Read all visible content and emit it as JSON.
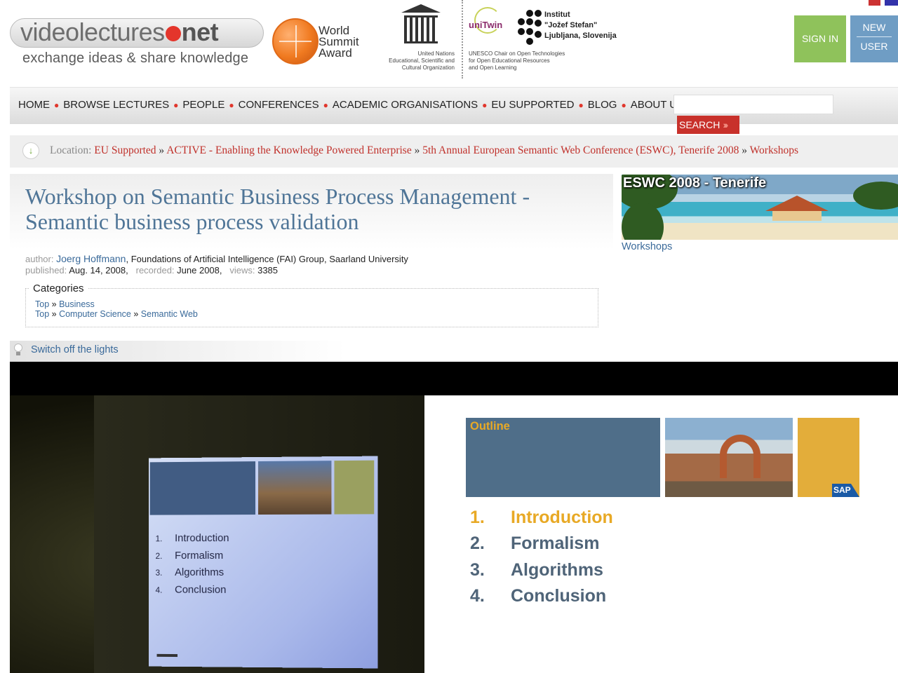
{
  "header": {
    "logo_text_main": "videolectures",
    "logo_text_net": "net",
    "logo_tagline": "exchange ideas & share knowledge",
    "award_lines": [
      "World",
      "Summit",
      "Award"
    ],
    "unesco_label": "United Nations\nEducational, Scientific and\nCultural Organization",
    "unitwin_text": "uniTwin",
    "unitwin_label": "UNESCO Chair on Open Technologies\nfor Open Educational Resources\nand Open Learning",
    "ijs_lines": [
      "Institut",
      "\"Jožef Stefan\"",
      "Ljubljana, Slovenija"
    ],
    "sign_in": "SIGN IN",
    "new_user_line1": "NEW",
    "new_user_line2": "USER"
  },
  "nav": {
    "items": [
      "HOME",
      "BROWSE LECTURES",
      "PEOPLE",
      "CONFERENCES",
      "ACADEMIC ORGANISATIONS",
      "EU SUPPORTED",
      "BLOG",
      "ABOUT US"
    ],
    "search_button": "SEARCH",
    "search_value": ""
  },
  "breadcrumb": {
    "label": "Location:",
    "items": [
      "EU Supported",
      "ACTIVE - Enabling the Knowledge Powered Enterprise",
      "5th Annual European Semantic Web Conference (ESWC), Tenerife 2008",
      "Workshops"
    ],
    "separator": "»"
  },
  "lecture": {
    "title": "Workshop on Semantic Business Process Management - Semantic business process validation",
    "author_label": "author:",
    "author_name": "Joerg Hoffmann",
    "author_affiliation": ", Foundations of Artificial Intelligence (FAI) Group, Saarland University",
    "published_label": "published:",
    "published": "Aug. 14, 2008,",
    "recorded_label": "recorded:",
    "recorded": "June 2008,",
    "views_label": "views:",
    "views": "3385"
  },
  "categories": {
    "legend": "Categories",
    "row1": [
      "Top",
      "Business"
    ],
    "row2": [
      "Top",
      "Computer Science",
      "Semantic Web"
    ],
    "sep": " » "
  },
  "banner": {
    "title": "ESWC 2008 - Tenerife",
    "link": "Workshops"
  },
  "lights": {
    "label": "Switch off the lights"
  },
  "slide": {
    "heading": "Outline",
    "sap": "SAP",
    "items": [
      {
        "num": "1.",
        "text": "Introduction"
      },
      {
        "num": "2.",
        "text": "Formalism"
      },
      {
        "num": "3.",
        "text": "Algorithms"
      },
      {
        "num": "4.",
        "text": "Conclusion"
      }
    ],
    "active_index": 0
  },
  "colors": {
    "accent_red": "#c8312b",
    "link_blue": "#3a6a9a",
    "title_blue": "#4f7597",
    "sign_in_green": "#8fc25b",
    "new_user_blue": "#6f9dc4",
    "slide_gold": "#e8a925",
    "slide_slate": "#4f6e89"
  }
}
